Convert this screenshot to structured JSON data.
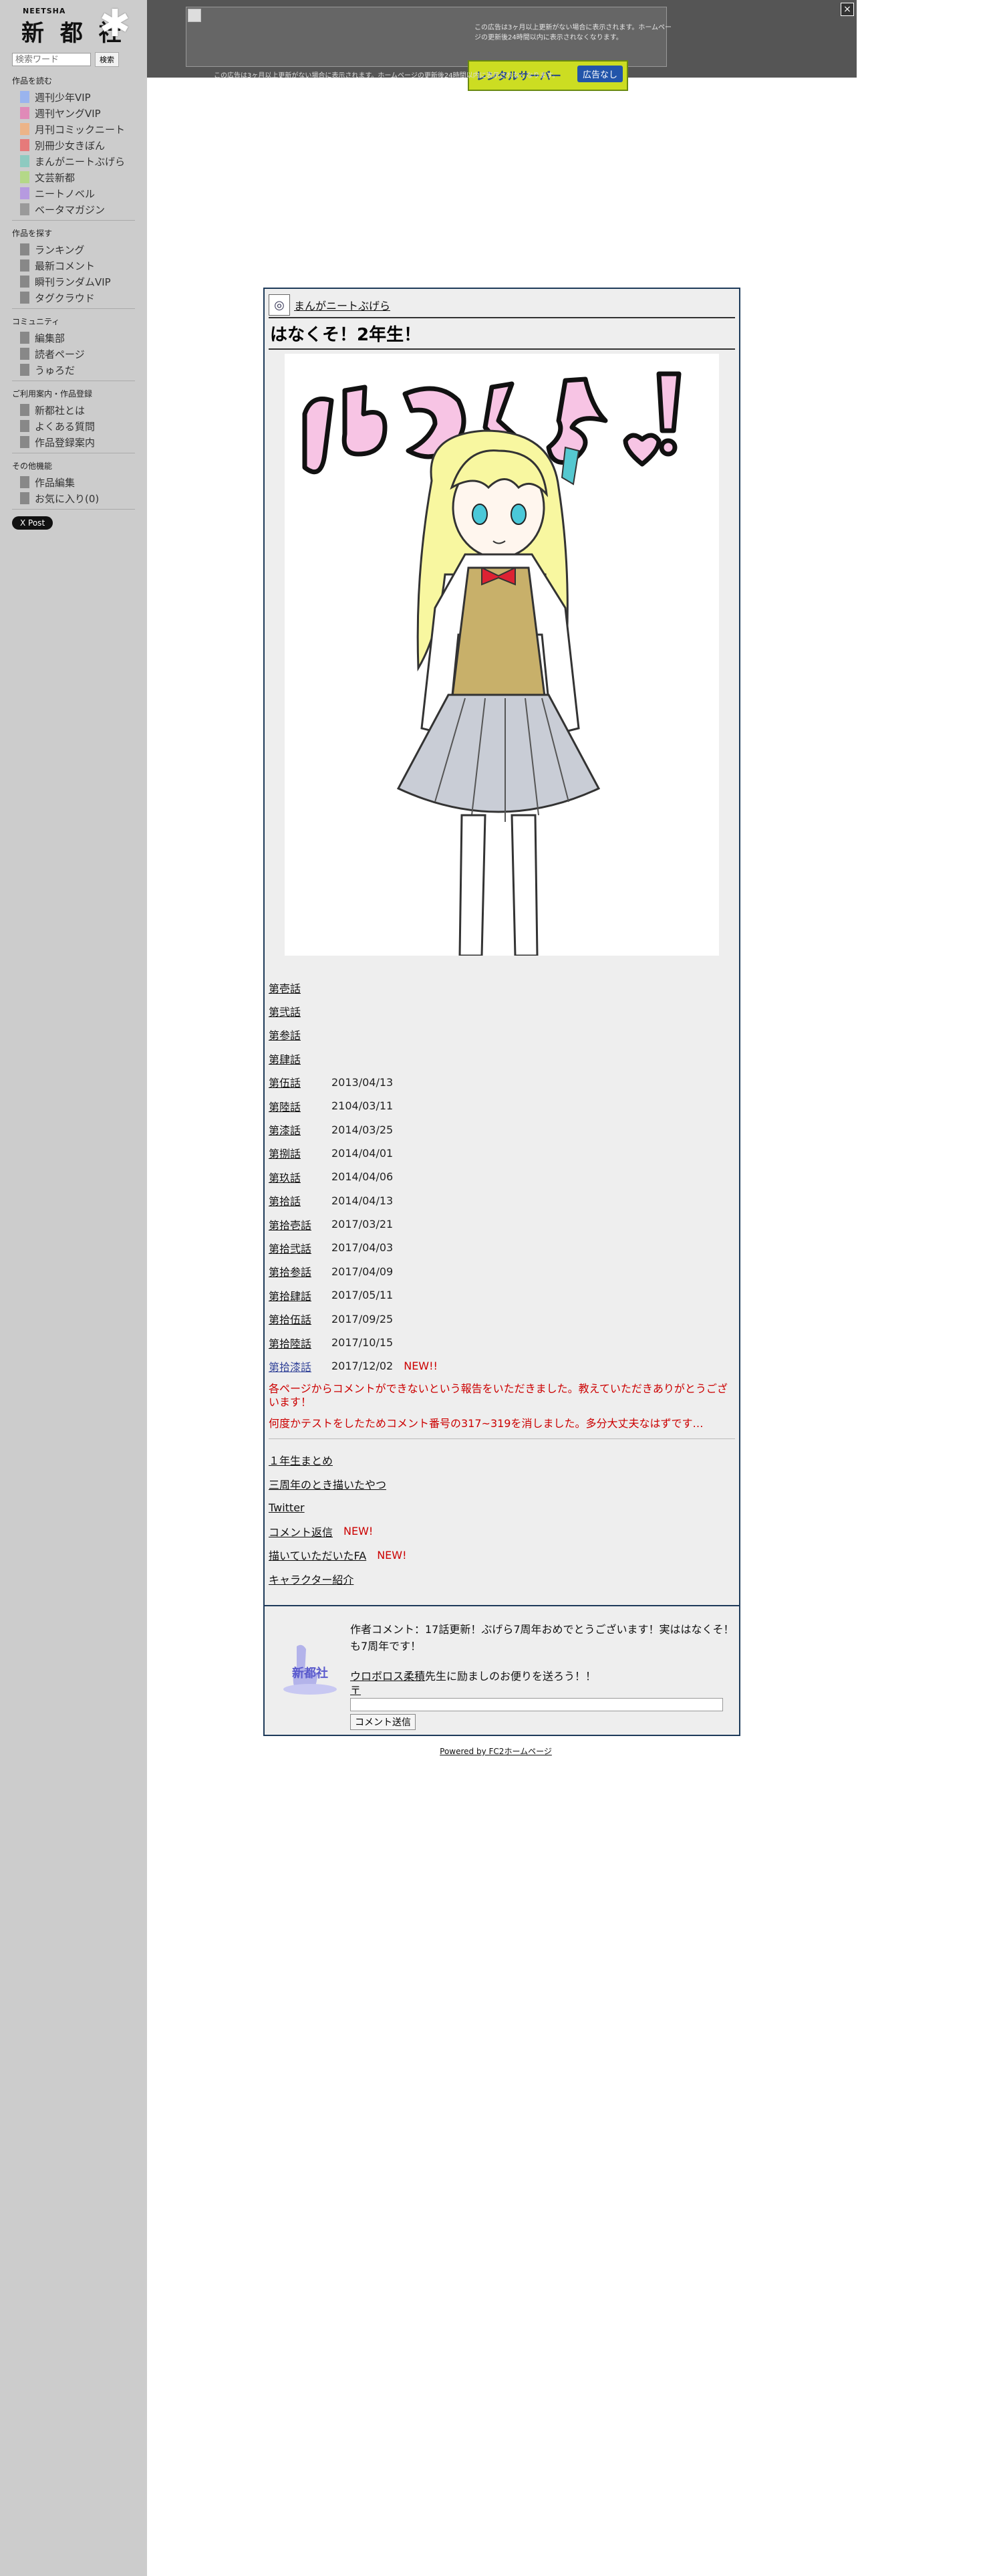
{
  "sidebar": {
    "logo_small": "NEETSHA",
    "logo_main": "新 都 社",
    "search_placeholder": "検索ワード",
    "search_button": "検索",
    "sections": [
      {
        "title": "作品を読む",
        "items": [
          {
            "label": "週刊少年VIP",
            "color": "#9ab4ee"
          },
          {
            "label": "週刊ヤングVIP",
            "color": "#e08ab8"
          },
          {
            "label": "月刊コミックニート",
            "color": "#ecb488"
          },
          {
            "label": "別冊少女きぼん",
            "color": "#e67a7a"
          },
          {
            "label": "まんがニートぶげら",
            "color": "#8ecac0"
          },
          {
            "label": "文芸新都",
            "color": "#b4d888"
          },
          {
            "label": "ニートノベル",
            "color": "#b69ae0"
          },
          {
            "label": "ベータマガジン",
            "color": "#9a9a9a"
          }
        ]
      },
      {
        "title": "作品を探す",
        "items": [
          {
            "label": "ランキング",
            "color": "#888888"
          },
          {
            "label": "最新コメント",
            "color": "#888888"
          },
          {
            "label": "瞬刊ランダムVIP",
            "color": "#888888"
          },
          {
            "label": "タグクラウド",
            "color": "#888888"
          }
        ]
      },
      {
        "title": "コミュニティ",
        "items": [
          {
            "label": "編集部",
            "color": "#888888"
          },
          {
            "label": "読者ページ",
            "color": "#888888"
          },
          {
            "label": "うゅろだ",
            "color": "#888888"
          }
        ]
      },
      {
        "title": "ご利用案内・作品登録",
        "items": [
          {
            "label": "新都社とは",
            "color": "#888888"
          },
          {
            "label": "よくある質問",
            "color": "#888888"
          },
          {
            "label": "作品登録案内",
            "color": "#888888"
          }
        ]
      },
      {
        "title": "その他機能",
        "items": [
          {
            "label": "作品編集",
            "color": "#888888"
          },
          {
            "label": "お気に入り(0)",
            "color": "#888888"
          }
        ]
      }
    ],
    "post_button": "X Post"
  },
  "ad": {
    "notice": "この広告は3ヶ月以上更新がない場合に表示されます。ホームページの更新後24時間以内に表示されなくなります。",
    "footnote": "この広告は3ヶ月以上更新がない場合に表示されます。ホームページの更新後24時間以内に表示されなくなります。",
    "badge_text": "レンタルサーバー",
    "badge_button": "広告なし",
    "close_label": "×"
  },
  "main": {
    "category_label": "まんがニートぶげら",
    "title": "はなくそ！2年生！",
    "episodes": [
      {
        "label": "第壱話",
        "date": ""
      },
      {
        "label": "第弐話",
        "date": ""
      },
      {
        "label": "第参話",
        "date": ""
      },
      {
        "label": "第肆話",
        "date": ""
      },
      {
        "label": "第伍話",
        "date": "2013/04/13"
      },
      {
        "label": "第陸話",
        "date": "2104/03/11"
      },
      {
        "label": "第漆話",
        "date": "2014/03/25"
      },
      {
        "label": "第捌話",
        "date": "2014/04/01"
      },
      {
        "label": "第玖話",
        "date": "2014/04/06"
      },
      {
        "label": "第拾話",
        "date": "2014/04/13"
      },
      {
        "label": "第拾壱話",
        "date": "2017/03/21"
      },
      {
        "label": "第拾弐話",
        "date": "2017/04/03"
      },
      {
        "label": "第拾参話",
        "date": "2017/04/09"
      },
      {
        "label": "第拾肆話",
        "date": "2017/05/11"
      },
      {
        "label": "第拾伍話",
        "date": "2017/09/25"
      },
      {
        "label": "第拾陸話",
        "date": "2017/10/15"
      },
      {
        "label": "第拾漆話",
        "date": "2017/12/02",
        "new": "NEW!!"
      }
    ],
    "notice_1": "各ページからコメントができないという報告をいただきました。教えていただきありがとうございます！",
    "notice_2": "何度かテストをしたためコメント番号の317~319を消しました。多分大丈夫なはずです…",
    "links": [
      {
        "label": "１年生まとめ"
      },
      {
        "label": "三周年のとき描いたやつ"
      },
      {
        "label": "Twitter"
      },
      {
        "label": "コメント返信",
        "new": "NEW!"
      },
      {
        "label": "描いていただいたFA",
        "new": "NEW!"
      },
      {
        "label": "キャラクター紹介"
      }
    ]
  },
  "comment_box": {
    "logo_text": "新都社",
    "author_comment": "作者コメント：17話更新！ぶげら7周年おめでとうございます！実ははなくそ！も7周年です！",
    "author_link": "ウロボロス柔積",
    "encourage_suffix": "先生に励ましのお便りを送ろう！！",
    "postal_mark": "〒",
    "submit_label": "コメント送信"
  },
  "footer": {
    "powered_by": "Powered by FC2ホームページ"
  }
}
